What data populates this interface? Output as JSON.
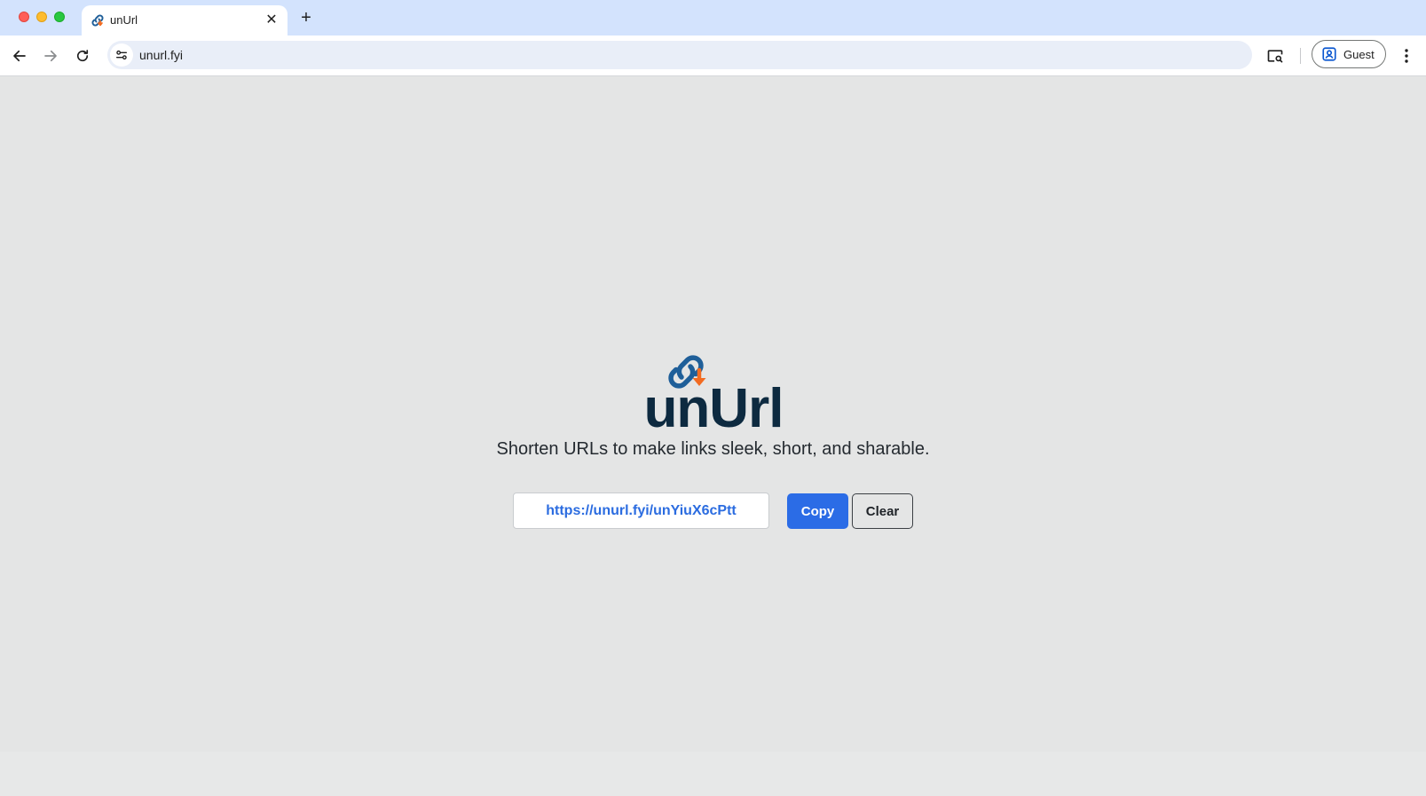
{
  "browser": {
    "tab": {
      "title": "unUrl",
      "close_symbol": "✕"
    },
    "new_tab_symbol": "+",
    "address": "unurl.fyi",
    "profile_label": "Guest",
    "icons": [
      "back-arrow-icon",
      "forward-arrow-icon",
      "reload-icon",
      "site-info-icon",
      "cast-icon",
      "profile-icon",
      "kebab-menu-icon"
    ]
  },
  "page": {
    "brand": "unUrl",
    "tagline": "Shorten URLs to make links sleek, short, and sharable.",
    "short_url": "https://unurl.fyi/unYiuX6cPtt",
    "copy_label": "Copy",
    "clear_label": "Clear"
  },
  "colors": {
    "tabbar": "#d3e3fd",
    "page_bg": "#e4e5e5",
    "brand_text": "#0d2a40",
    "logo_blue": "#1f5f99",
    "logo_orange": "#f26b21",
    "accent_blue": "#2b6ce6"
  }
}
